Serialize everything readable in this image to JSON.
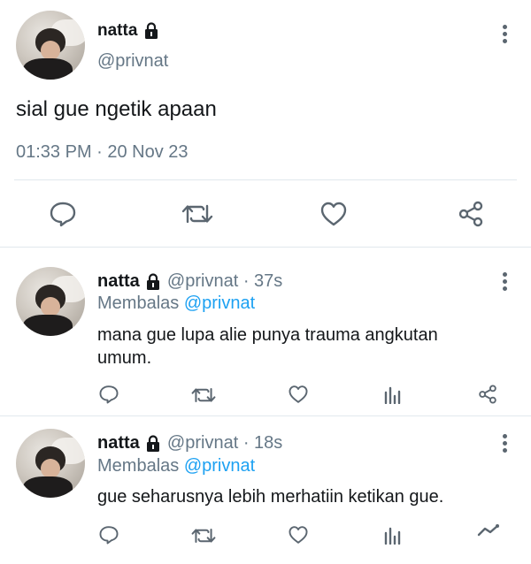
{
  "main_tweet": {
    "name": "natta",
    "handle": "@privnat",
    "text": "sial gue ngetik apaan",
    "timestamp": "01:33 PM · 20 Nov 23",
    "actions": [
      "reply-icon",
      "retweet-icon",
      "like-icon",
      "share-icon"
    ]
  },
  "replies": [
    {
      "name": "natta",
      "handle": "@privnat",
      "time": "· 37s",
      "replying_prefix": "Membalas",
      "replying_to": "@privnat",
      "text": "mana gue lupa alie punya trauma angkutan umum."
    },
    {
      "name": "natta",
      "handle": "@privnat",
      "time": "· 18s",
      "replying_prefix": "Membalas",
      "replying_to": "@privnat",
      "text": "gue seharusnya lebih merhatiin ketikan gue."
    }
  ],
  "colors": {
    "text": "#14171a",
    "secondary": "#657786",
    "link": "#1da1f2",
    "icon": "#5b6670",
    "divider": "#e1e8ed"
  }
}
